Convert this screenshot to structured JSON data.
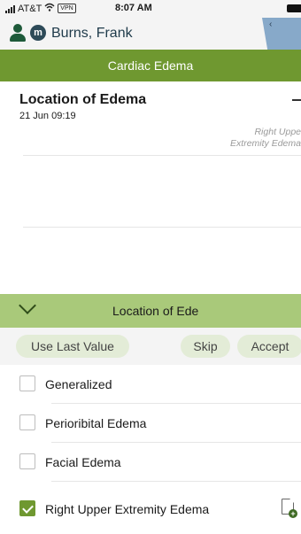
{
  "status_bar": {
    "carrier": "AT&T",
    "vpn": "VPN",
    "time": "8:07 AM"
  },
  "patient": {
    "badge": "m",
    "name": "Burns, Frank",
    "back_chevron": "‹"
  },
  "header": {
    "title": "Cardiac Edema"
  },
  "detail": {
    "title": "Location of Edema",
    "datetime": "21 Jun 09:19",
    "value_line1": "Right Uppe",
    "value_line2": "Extremity Edema"
  },
  "picker": {
    "title": "Location of Ede"
  },
  "actions": {
    "use_last_value": "Use Last Value",
    "skip": "Skip",
    "accept": "Accept"
  },
  "options": [
    {
      "label": "Generalized",
      "checked": false
    },
    {
      "label": "Perioribital Edema",
      "checked": false
    },
    {
      "label": "Facial Edema",
      "checked": false
    },
    {
      "label": "Right Upper Extremity Edema",
      "checked": true
    }
  ],
  "colors": {
    "header_green": "#6f9830",
    "picker_green": "#a9c97a",
    "pill_bg": "#e3ecd7",
    "tab_blue": "#87a9c9"
  },
  "icons": {
    "signal": "signal-icon",
    "wifi": "wifi-icon",
    "battery": "battery-icon",
    "person": "person-icon",
    "collapse": "chevron-down-icon",
    "minus": "minus-icon",
    "note": "add-note-icon"
  }
}
